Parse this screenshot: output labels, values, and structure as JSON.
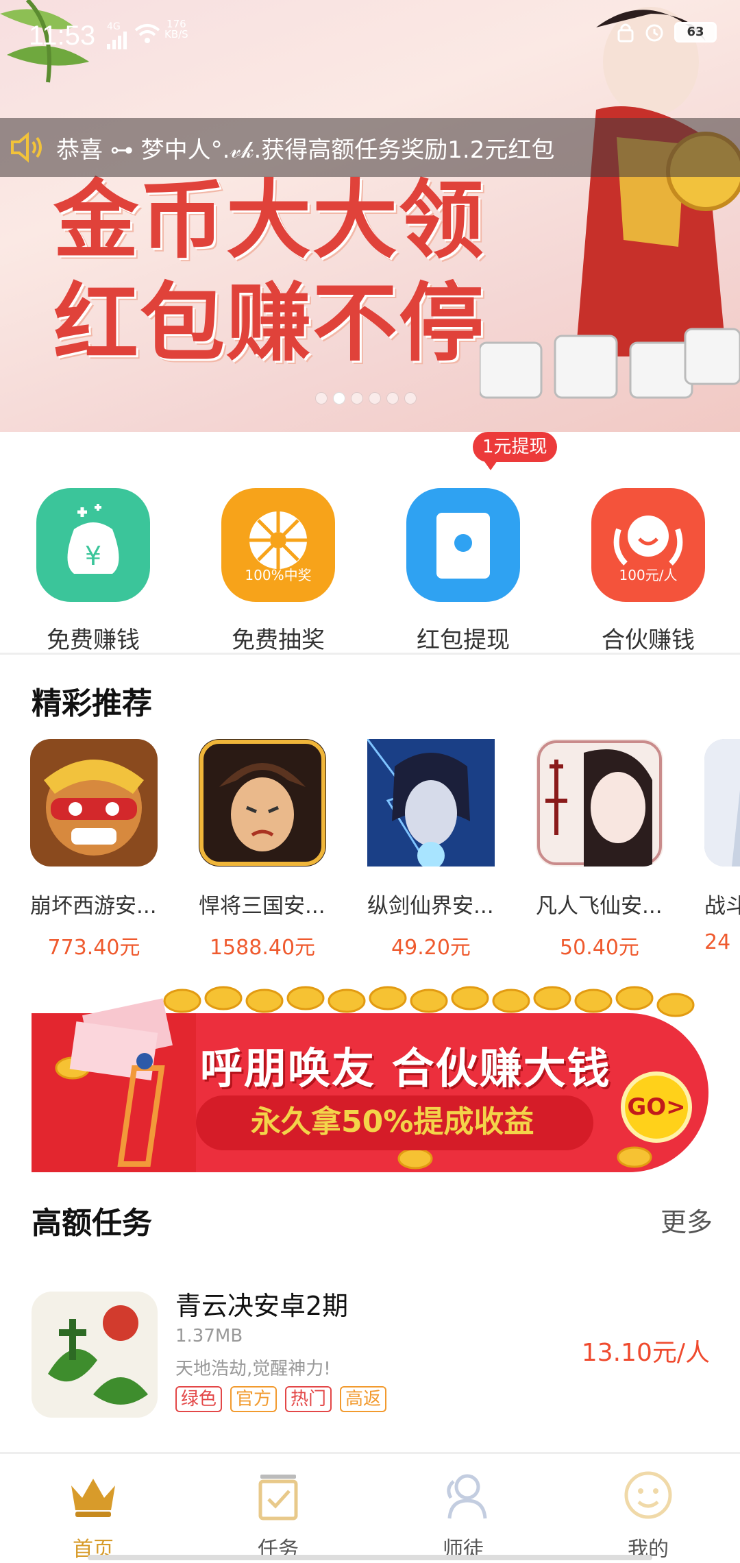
{
  "status_bar": {
    "time": "11:53",
    "network": "4G",
    "speed_value": "176",
    "speed_unit": "KB/S",
    "battery": "63"
  },
  "banner": {
    "logo_text": "",
    "headline_line1": "金币大大领",
    "headline_line2": "红包赚不停",
    "dots_count": 6,
    "active_dot": 1
  },
  "notice": {
    "text": "恭喜 ⊶ 梦中人°.𝓋𝓀.获得高额任务奖励1.2元红包"
  },
  "quick_entries": [
    {
      "label": "免费赚钱",
      "sub": "",
      "icon": "money-bag-icon",
      "color": "#3bc59a"
    },
    {
      "label": "免费抽奖",
      "sub": "100%中奖",
      "icon": "lottery-wheel-icon",
      "color": "#f7a31a"
    },
    {
      "label": "红包提现",
      "sub": "",
      "icon": "red-envelope-icon",
      "color": "#2fa2f2",
      "badge": "1元提现"
    },
    {
      "label": "合伙赚钱",
      "sub": "100元/人",
      "icon": "partner-icon",
      "color": "#f4533b"
    }
  ],
  "recommend": {
    "title": "精彩推荐",
    "items": [
      {
        "name": "崩坏西游安...",
        "price": "773.40元"
      },
      {
        "name": "悍将三国安...",
        "price": "1588.40元"
      },
      {
        "name": "纵剑仙界安...",
        "price": "49.20元"
      },
      {
        "name": "凡人飞仙安...",
        "price": "50.40元"
      },
      {
        "name": "战斗",
        "price": "24"
      }
    ]
  },
  "promo": {
    "title": "呼朋唤友 合伙赚大钱",
    "subtitle": "永久拿50%提成收益",
    "go_label": "GO>"
  },
  "tasks": {
    "title": "高额任务",
    "more_label": "更多",
    "items": [
      {
        "name": "青云决安卓2期",
        "size": "1.37MB",
        "desc": "天地浩劫,觉醒神力!",
        "tags": [
          "绿色",
          "官方",
          "热门",
          "高返"
        ],
        "price": "13.10元/人"
      }
    ]
  },
  "bottom_nav": [
    {
      "label": "首页",
      "icon": "crown-icon",
      "active": true
    },
    {
      "label": "任务",
      "icon": "task-checkbox-icon",
      "active": false
    },
    {
      "label": "师徒",
      "icon": "mentor-icon",
      "active": false
    },
    {
      "label": "我的",
      "icon": "smiley-icon",
      "active": false
    }
  ],
  "colors": {
    "accent_orange": "#ef5a2e",
    "nav_active": "#d79b2a",
    "badge_red": "#ec3a3a"
  }
}
